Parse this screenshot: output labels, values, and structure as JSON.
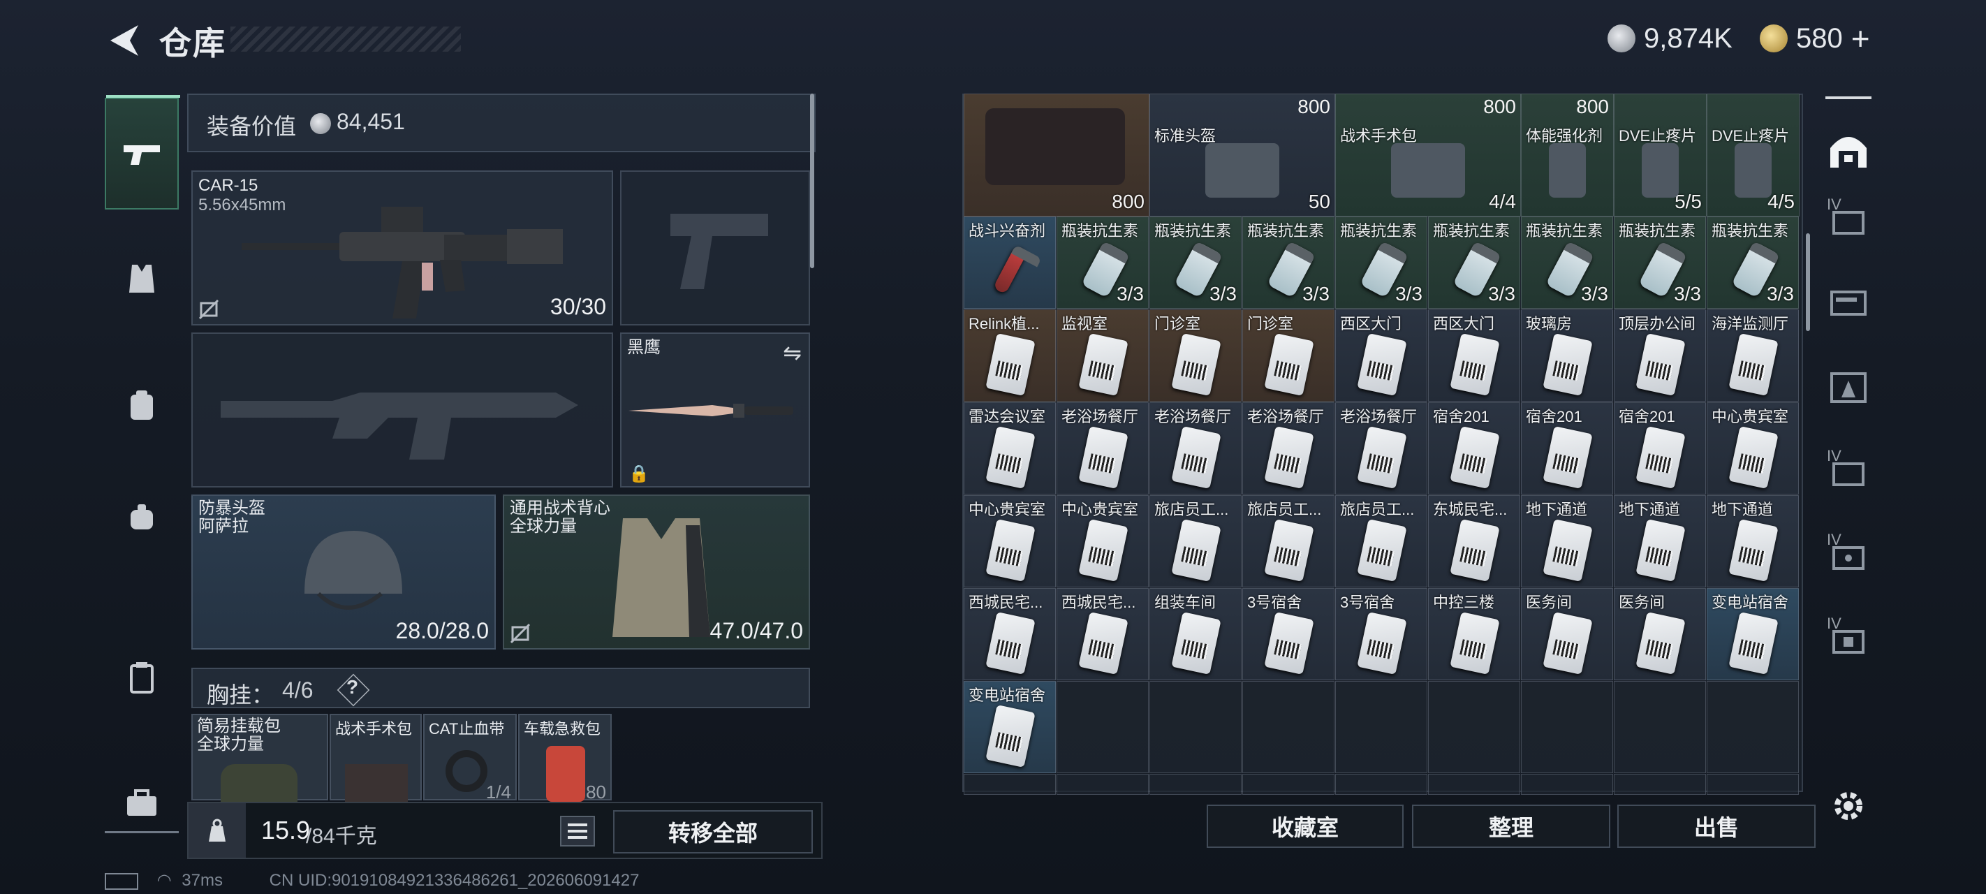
{
  "header": {
    "title": "仓库",
    "currency_silver": "9,874K",
    "currency_gold": "580",
    "gold_plus": "+"
  },
  "equipment": {
    "value_label": "装备价值",
    "value": "84,451",
    "primary_weapon": {
      "name": "CAR-15",
      "caliber": "5.56x45mm",
      "ammo": "30/30"
    },
    "melee": {
      "name": "黑鹰"
    },
    "helmet": {
      "name": "防暴头盔",
      "sub": "阿萨拉",
      "durability": "28.0/28.0"
    },
    "vest": {
      "name": "通用战术背心",
      "sub": "全球力量",
      "durability": "47.0/47.0"
    },
    "chest_rig": {
      "label": "胸挂：",
      "count": "4/6",
      "help": "?"
    },
    "rig_items": [
      {
        "name": "简易挂载包",
        "sub": "全球力量"
      },
      {
        "name": "战术手术包",
        "sub": ""
      },
      {
        "name": "CAT止血带",
        "sub": "",
        "qty": "1/4"
      },
      {
        "name": "车载急救包",
        "sub": "",
        "qty": "80"
      }
    ],
    "weight": "15.9",
    "weight_max": "/84千克",
    "transfer_all": "转移全部"
  },
  "inventory": {
    "top_row": [
      {
        "name": "",
        "qty": "800",
        "bg": "tan"
      },
      {
        "name": "标准头盔",
        "qty": "50",
        "top_qty": "800",
        "bg": "default"
      },
      {
        "name": "战术手术包",
        "qty": "4/4",
        "top_qty": "800",
        "bg": "green"
      },
      {
        "name": "体能强化剂",
        "qty": "",
        "top_qty": "800",
        "bg": "green"
      },
      {
        "name": "DVE止疼片",
        "qty": "5/5",
        "bg": "green"
      },
      {
        "name": "DVE止疼片",
        "qty": "4/5",
        "bg": "green"
      }
    ],
    "rows": [
      [
        {
          "name": "战斗兴奋剂",
          "qty": "",
          "bg": "blue",
          "art": "syringe"
        },
        {
          "name": "瓶装抗生素",
          "qty": "3/3",
          "bg": "green",
          "art": "pill"
        },
        {
          "name": "瓶装抗生素",
          "qty": "3/3",
          "bg": "green",
          "art": "pill"
        },
        {
          "name": "瓶装抗生素",
          "qty": "3/3",
          "bg": "green",
          "art": "pill"
        },
        {
          "name": "瓶装抗生素",
          "qty": "3/3",
          "bg": "green",
          "art": "pill"
        },
        {
          "name": "瓶装抗生素",
          "qty": "3/3",
          "bg": "green",
          "art": "pill"
        },
        {
          "name": "瓶装抗生素",
          "qty": "3/3",
          "bg": "green",
          "art": "pill"
        },
        {
          "name": "瓶装抗生素",
          "qty": "3/3",
          "bg": "green",
          "art": "pill"
        },
        {
          "name": "瓶装抗生素",
          "qty": "3/3",
          "bg": "green",
          "art": "pill"
        }
      ],
      [
        {
          "name": "Relink植...",
          "bg": "tan",
          "art": "card"
        },
        {
          "name": "监视室",
          "bg": "tan",
          "art": "card"
        },
        {
          "name": "门诊室",
          "bg": "tan",
          "art": "card"
        },
        {
          "name": "门诊室",
          "bg": "tan",
          "art": "card"
        },
        {
          "name": "西区大门",
          "bg": "default",
          "art": "card"
        },
        {
          "name": "西区大门",
          "bg": "default",
          "art": "card"
        },
        {
          "name": "玻璃房",
          "bg": "default",
          "art": "card"
        },
        {
          "name": "顶层办公间",
          "bg": "default",
          "art": "card"
        },
        {
          "name": "海洋监测厅",
          "bg": "default",
          "art": "card"
        }
      ],
      [
        {
          "name": "雷达会议室",
          "bg": "default",
          "art": "card"
        },
        {
          "name": "老浴场餐厅",
          "bg": "default",
          "art": "card"
        },
        {
          "name": "老浴场餐厅",
          "bg": "default",
          "art": "card"
        },
        {
          "name": "老浴场餐厅",
          "bg": "default",
          "art": "card"
        },
        {
          "name": "老浴场餐厅",
          "bg": "default",
          "art": "card"
        },
        {
          "name": "宿舍201",
          "bg": "default",
          "art": "card"
        },
        {
          "name": "宿舍201",
          "bg": "default",
          "art": "card"
        },
        {
          "name": "宿舍201",
          "bg": "default",
          "art": "card"
        },
        {
          "name": "中心贵宾室",
          "bg": "default",
          "art": "card"
        }
      ],
      [
        {
          "name": "中心贵宾室",
          "bg": "default",
          "art": "card"
        },
        {
          "name": "中心贵宾室",
          "bg": "default",
          "art": "card"
        },
        {
          "name": "旅店员工...",
          "bg": "default",
          "art": "card"
        },
        {
          "name": "旅店员工...",
          "bg": "default",
          "art": "card"
        },
        {
          "name": "旅店员工...",
          "bg": "default",
          "art": "card"
        },
        {
          "name": "东城民宅...",
          "bg": "default",
          "art": "card"
        },
        {
          "name": "地下通道",
          "bg": "default",
          "art": "card"
        },
        {
          "name": "地下通道",
          "bg": "default",
          "art": "card"
        },
        {
          "name": "地下通道",
          "bg": "default",
          "art": "card"
        }
      ],
      [
        {
          "name": "西城民宅...",
          "bg": "default",
          "art": "card"
        },
        {
          "name": "西城民宅...",
          "bg": "default",
          "art": "card"
        },
        {
          "name": "组装车间",
          "bg": "default",
          "art": "card"
        },
        {
          "name": "3号宿舍",
          "bg": "default",
          "art": "card"
        },
        {
          "name": "3号宿舍",
          "bg": "default",
          "art": "card"
        },
        {
          "name": "中控三楼",
          "bg": "default",
          "art": "card"
        },
        {
          "name": "医务间",
          "bg": "default",
          "art": "card"
        },
        {
          "name": "医务间",
          "bg": "default",
          "art": "card"
        },
        {
          "name": "变电站宿舍",
          "bg": "blue",
          "art": "card"
        }
      ],
      [
        {
          "name": "变电站宿舍",
          "bg": "blue",
          "art": "card"
        }
      ]
    ],
    "buttons": {
      "collection": "收藏室",
      "sort": "整理",
      "sell": "出售"
    }
  },
  "rightnav_labels": [
    "IV",
    "IV",
    "IV",
    "IV",
    "IV"
  ],
  "status": {
    "ping": "37ms",
    "uid": "CN UID:901910849213364862​61_202606091427"
  },
  "colors": {
    "accent_green": "#3c7a64",
    "panel": "#262f3c"
  }
}
